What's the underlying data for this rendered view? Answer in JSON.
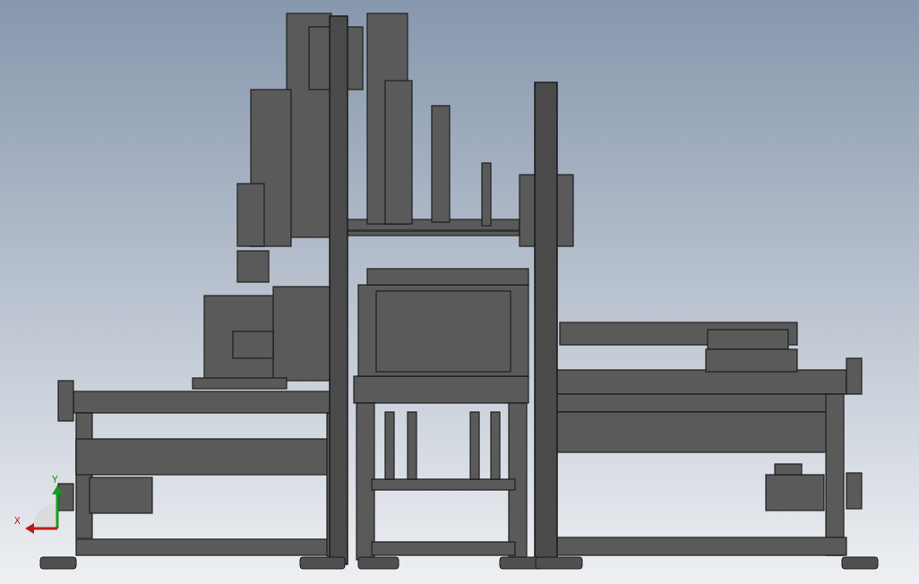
{
  "viewport": {
    "axis_triad": {
      "x_label": "X",
      "y_label": "Y"
    }
  }
}
